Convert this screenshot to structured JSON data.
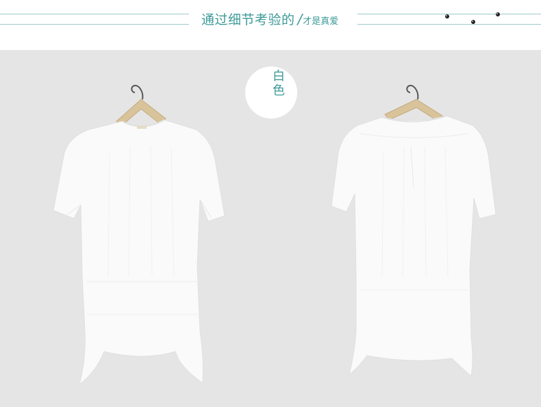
{
  "header": {
    "title_main": "通过细节考验的",
    "slash": "/",
    "title_sub": "才是真爱"
  },
  "badge": {
    "label": "白色",
    "chars": [
      "白",
      "色"
    ]
  },
  "colors": {
    "accent": "#3d9a98",
    "photo_background": "#e6e5e6",
    "shirt": "#fafafa",
    "hanger_wood": "#d9c39a"
  },
  "images": {
    "front": "white-shirt-front-on-hanger",
    "back": "white-shirt-back-on-hanger"
  }
}
